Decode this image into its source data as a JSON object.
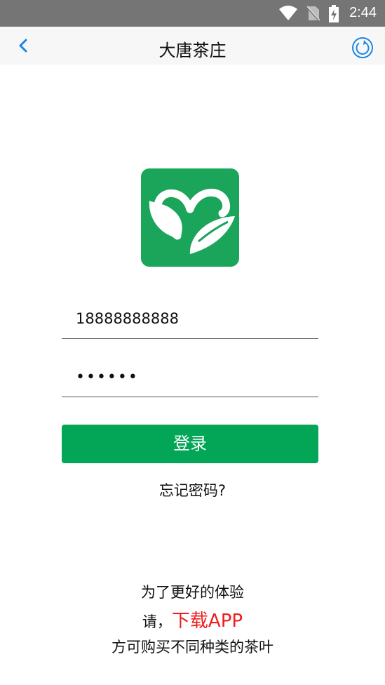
{
  "status_bar": {
    "time": "2:44",
    "icons": [
      "wifi-icon",
      "no-sim-icon",
      "battery-charging-icon"
    ]
  },
  "nav": {
    "title": "大唐茶庄",
    "back_icon": "chevron-left-icon",
    "refresh_icon": "refresh-icon",
    "accent_color": "#1a86e8"
  },
  "logo": {
    "icon": "heart-leaf-logo",
    "background_color": "#1aa55a"
  },
  "login_form": {
    "phone_value": "18888888888",
    "password_value": "••••••",
    "login_label": "登录",
    "login_color": "#03a657",
    "forgot_label": "忘记密码?"
  },
  "promo": {
    "line1": "为了更好的体验",
    "line2_prefix": "请，",
    "download_label": "下载APP",
    "download_color": "#ee1c1c",
    "line3": "方可购买不同种类的茶叶"
  }
}
